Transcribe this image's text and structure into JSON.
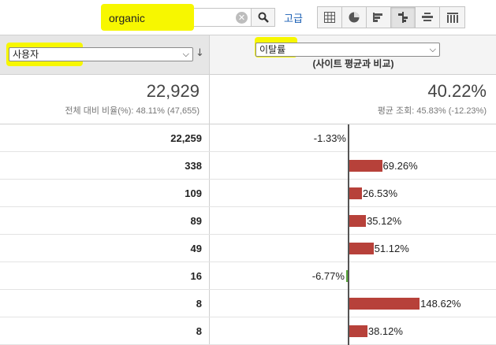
{
  "search": {
    "value": "organic",
    "clear_icon": "clear-icon",
    "button_icon": "magnifier-icon"
  },
  "toolbar": {
    "advanced_label": "고급",
    "views": [
      {
        "icon": "table-view-icon",
        "active": false
      },
      {
        "icon": "pie-view-icon",
        "active": false
      },
      {
        "icon": "performance-view-icon",
        "active": false
      },
      {
        "icon": "comparison-view-icon",
        "active": true
      },
      {
        "icon": "term-cloud-view-icon",
        "active": false
      },
      {
        "icon": "pivot-view-icon",
        "active": false
      }
    ]
  },
  "columns": {
    "left_metric": "사용자",
    "right_metric": "이탈률",
    "right_caption": "(사이트 평균과 비교)"
  },
  "summary": {
    "users_total": "22,929",
    "users_sub": "전체 대비 비율(%): 48.11% (47,655)",
    "bounce_total": "40.22%",
    "bounce_sub": "평균 조회: 45.83% (-12.23%)"
  },
  "colors": {
    "positive_bar": "#b7413a",
    "negative_bar": "#5aa83c",
    "highlight": "#f7f700"
  },
  "rows": [
    {
      "users": "22,259",
      "delta": -1.33,
      "label": "-1.33%"
    },
    {
      "users": "338",
      "delta": 69.26,
      "label": "69.26%"
    },
    {
      "users": "109",
      "delta": 26.53,
      "label": "26.53%"
    },
    {
      "users": "89",
      "delta": 35.12,
      "label": "35.12%"
    },
    {
      "users": "49",
      "delta": 51.12,
      "label": "51.12%"
    },
    {
      "users": "16",
      "delta": -6.77,
      "label": "-6.77%"
    },
    {
      "users": "8",
      "delta": 148.62,
      "label": "148.62%"
    },
    {
      "users": "8",
      "delta": 38.12,
      "label": "38.12%"
    }
  ]
}
